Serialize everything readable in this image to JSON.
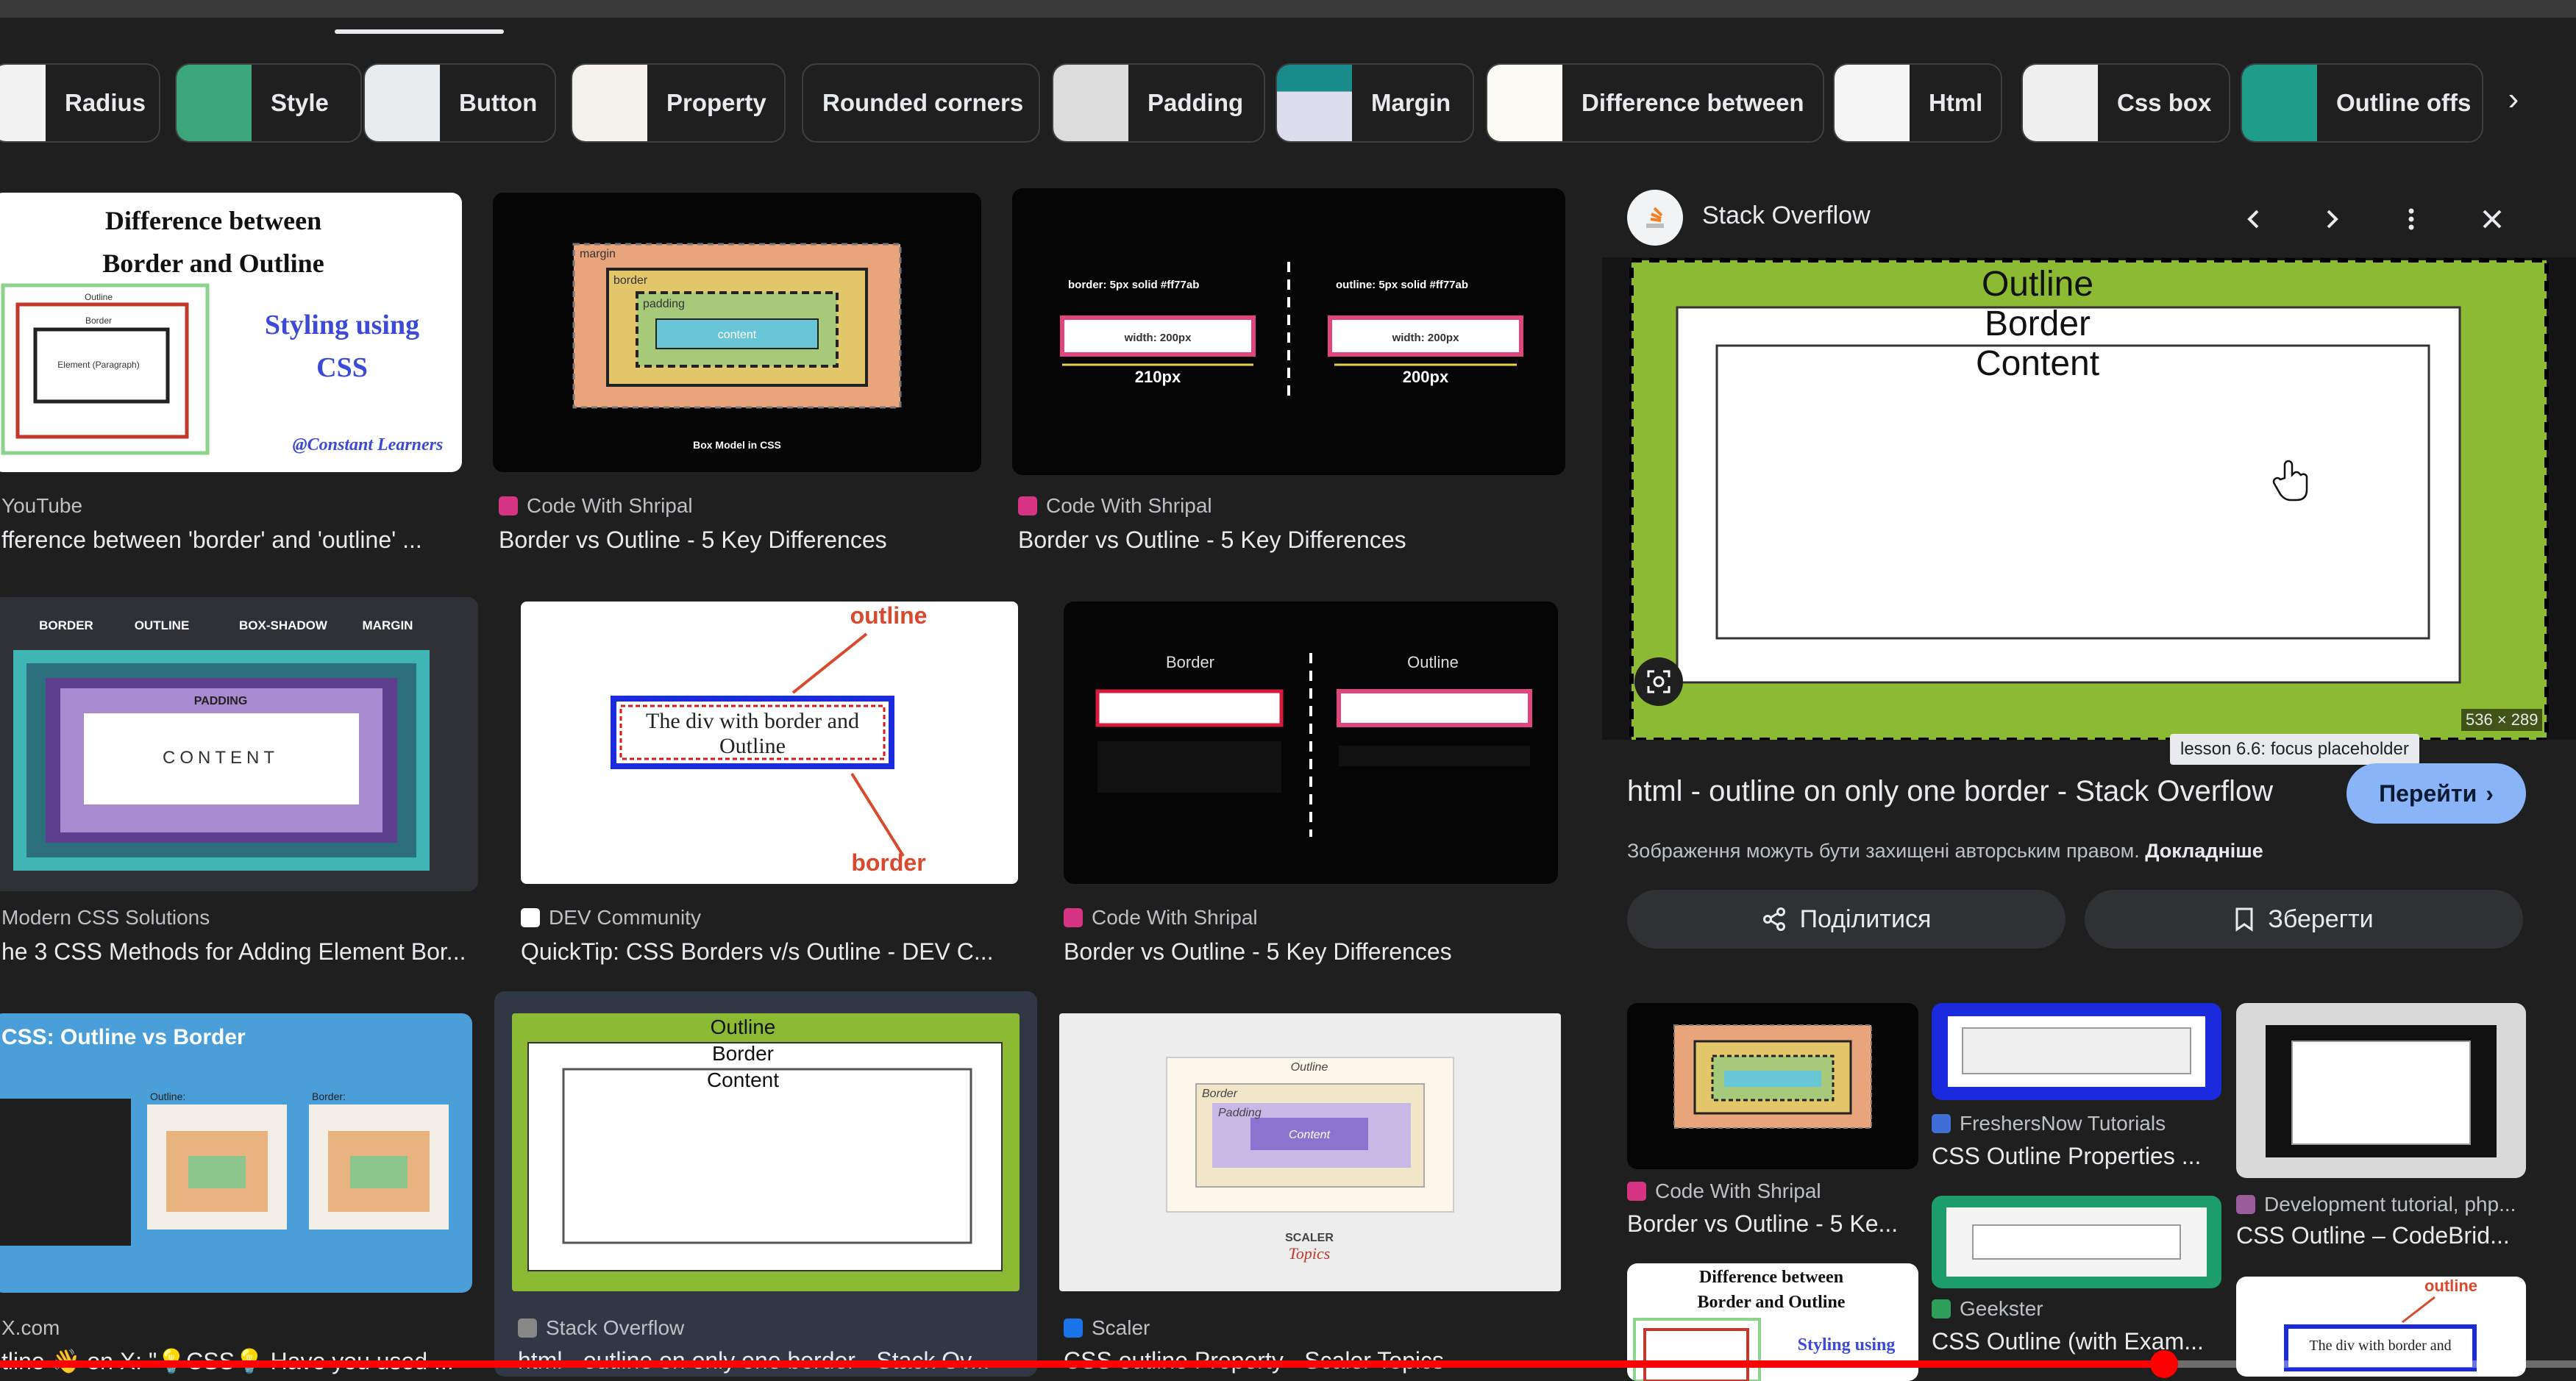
{
  "chips": [
    {
      "label": "Radius"
    },
    {
      "label": "Style"
    },
    {
      "label": "Button"
    },
    {
      "label": "Property"
    },
    {
      "label": "Rounded corners"
    },
    {
      "label": "Padding"
    },
    {
      "label": "Margin"
    },
    {
      "label": "Difference between"
    },
    {
      "label": "Html"
    },
    {
      "label": "Css box"
    },
    {
      "label": "Outline offs"
    }
  ],
  "results": [
    {
      "source": "YouTube",
      "title": "fference between 'border' and 'outline' ...",
      "thumb": {
        "line1": "Difference between",
        "line2": "Border and Outline",
        "side1": "Styling using",
        "side2": "CSS",
        "credit": "@Constant Learners",
        "l1": "Outline",
        "l2": "Border",
        "l3": "Element (Paragraph)"
      }
    },
    {
      "source": "Code With Shripal",
      "title": "Border vs Outline - 5 Key Differences",
      "thumb": {
        "margin": "margin",
        "border": "border",
        "padding": "padding",
        "content": "content",
        "caption": "Box Model in CSS"
      }
    },
    {
      "source": "Code With Shripal",
      "title": "Border vs Outline - 5 Key Differences",
      "thumb": {
        "l1": "border: 5px solid #ff77ab",
        "l2": "outline: 5px solid #ff77ab",
        "w1": "width: 200px",
        "w2": "width: 200px",
        "m1": "210px",
        "m2": "200px"
      }
    },
    {
      "source": "Modern CSS Solutions",
      "title": "he 3 CSS Methods for Adding Element Bor...",
      "thumb": {
        "t1": "BORDER",
        "t2": "OUTLINE",
        "t3": "BOX-SHADOW",
        "t4": "MARGIN",
        "padding": "PADDING",
        "content": "CONTENT"
      }
    },
    {
      "source": "DEV Community",
      "title": "QuickTip: CSS Borders v/s Outline - DEV C...",
      "thumb": {
        "outline": "outline",
        "border": "border",
        "text": "The div with border and Outline"
      }
    },
    {
      "source": "Code With Shripal",
      "title": "Border vs Outline - 5 Key Differences",
      "thumb": {
        "left": "Border",
        "right": "Outline"
      }
    },
    {
      "source": "X.com",
      "title": "tline 👋 on X: \"💡CSS💡 Have you used ...",
      "thumb": {
        "title": "CSS: Outline vs Border",
        "a": "Outline:",
        "b": "Border:"
      }
    },
    {
      "source": "Stack Overflow",
      "title": "html - outline on only one border - Stack Ov...",
      "thumb": {
        "outline": "Outline",
        "border": "Border",
        "content": "Content"
      }
    },
    {
      "source": "Scaler",
      "title": "CSS outline Property - Scaler Topics",
      "thumb": {
        "outline": "Outline",
        "border": "Border",
        "padding": "Padding",
        "content": "Content",
        "brand": "SCALER",
        "brand2": "Topics"
      }
    }
  ],
  "panel": {
    "site": "Stack Overflow",
    "preview": {
      "outline": "Outline",
      "border": "Border",
      "content": "Content",
      "size": "536 × 289"
    },
    "title": "html - outline on only one border - Stack Overflow",
    "visit": "Перейти",
    "notice": "Зображення можуть бути захищені авторським правом.",
    "notice_link": "Докладніше",
    "share": "Поділитися",
    "save": "Зберегти",
    "tooltip": "lesson 6.6: focus placeholder",
    "related": [
      {
        "source": "Code With Shripal",
        "title": "Border vs Outline - 5 Ke..."
      },
      {
        "source": "FreshersNow Tutorials",
        "title": "CSS Outline Properties ..."
      },
      {
        "source": "Development tutorial, php...",
        "title": "CSS Outline – CodeBrid..."
      },
      {
        "source": "Geekster",
        "title": "CSS Outline (with Exam..."
      }
    ],
    "related_thumbs": {
      "t1": "Difference between",
      "t2": "Border and Outline",
      "t3": "Styling using",
      "t4": "outline",
      "t5": "The div with border and"
    }
  },
  "video": {
    "progress": 0.84
  },
  "colors": {
    "accent": "#8ab4f8",
    "progress": "#ff0000",
    "lime": "#8cba32"
  }
}
